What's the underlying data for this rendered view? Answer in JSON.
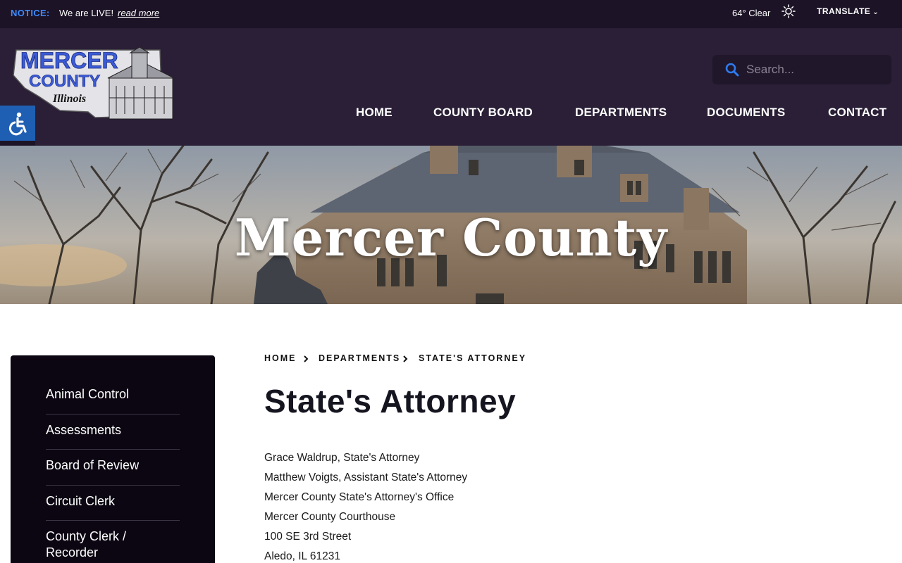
{
  "notice": {
    "label": "NOTICE:",
    "text": "We are LIVE!",
    "link": "read more"
  },
  "weather": {
    "text": "64° Clear",
    "icon": "sun-icon"
  },
  "translate": {
    "label": "TRANSLATE"
  },
  "logo": {
    "line1": "MERCER",
    "line2": "COUNTY",
    "line3": "Illinois"
  },
  "search": {
    "placeholder": "Search..."
  },
  "nav": {
    "items": [
      "HOME",
      "COUNTY BOARD",
      "DEPARTMENTS",
      "DOCUMENTS",
      "CONTACT"
    ]
  },
  "hero": {
    "title": "Mercer County"
  },
  "sidebar": {
    "items": [
      "Animal Control",
      "Assessments",
      "Board of Review",
      "Circuit Clerk",
      "County Clerk / Recorder"
    ]
  },
  "breadcrumb": {
    "items": [
      "HOME",
      "DEPARTMENTS",
      "STATE'S ATTORNEY"
    ]
  },
  "page": {
    "title": "State's Attorney",
    "lines": [
      "Grace Waldrup, State's Attorney",
      "Matthew Voigts, Assistant State's Attorney",
      "Mercer County State's Attorney's Office",
      "Mercer County Courthouse",
      "100 SE 3rd Street",
      "Aledo, IL 61231"
    ]
  },
  "colors": {
    "notice_bar": "#1c1326",
    "header": "#2a1f36",
    "accent_blue": "#3d8bff",
    "sidebar": "#0c0612",
    "access_button": "#1f5fb3"
  }
}
